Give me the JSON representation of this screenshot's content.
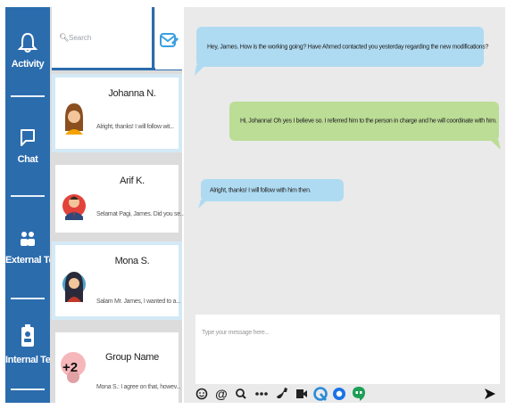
{
  "nav": {
    "items": [
      {
        "label": "Activity",
        "icon": "bell-icon"
      },
      {
        "label": "Chat",
        "icon": "chat-icon"
      },
      {
        "label": "External Team",
        "icon": "team-icon"
      },
      {
        "label": "Internal Team",
        "icon": "badge-icon"
      }
    ]
  },
  "search": {
    "placeholder": "Search"
  },
  "conversations": [
    {
      "name": "Johanna N.",
      "preview": "Alright, thanks! I will follow wit..."
    },
    {
      "name": "Arif K.",
      "preview": "Selamat Pagi, James. Did you se..."
    },
    {
      "name": "Mona S.",
      "preview": "Salam Mr. James, I wanted to a..."
    },
    {
      "name": "Group Name",
      "preview": "Mona S.: I agree on that, howev...",
      "badge": "+2"
    }
  ],
  "messages": [
    {
      "dir": "in",
      "text": "Hey, James. How is the working going? Have Ahmed contacted you yesterday regarding the new modifications?"
    },
    {
      "dir": "out",
      "text": "Hi, Johanna! Oh yes I believe so. I referred him to the person in charge and he will coordinate with him."
    },
    {
      "dir": "in",
      "text": "Alright, thanks! I will follow with him then."
    }
  ],
  "composer": {
    "placeholder": "Type your message here..."
  },
  "colors": {
    "nav": "#2b6cad",
    "incoming": "#afdbf2",
    "outgoing": "#bcdd96",
    "chat_bg": "#eaeaea",
    "card_border": "#d4e9f6"
  }
}
